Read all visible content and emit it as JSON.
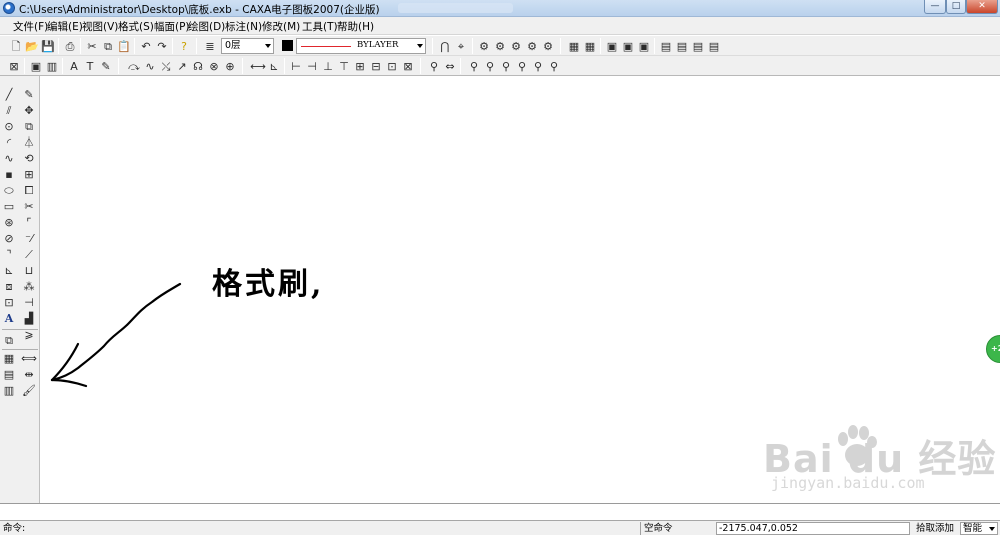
{
  "window": {
    "title": "C:\\Users\\Administrator\\Desktop\\底板.exb - CAXA电子图板2007(企业版)",
    "min_glyph": "—",
    "max_glyph": "□",
    "close_glyph": "✕"
  },
  "menu": [
    "文件(F)",
    "编辑(E)",
    "视图(V)",
    "格式(S)",
    "幅面(P)",
    "绘图(D)",
    "标注(N)",
    "修改(M)",
    "工具(T)",
    "帮助(H)"
  ],
  "toolbar": {
    "layer_value": "0层",
    "color_value": "#000000",
    "linetype_value": "BYLAYER",
    "line_color": "#e0262d"
  },
  "canvas": {
    "annotation": "格式刷,",
    "side_badge": "+2"
  },
  "watermark": {
    "brand": "Bai  du 经验",
    "url": "jingyan.baidu.com"
  },
  "status": {
    "command_label": "命令:",
    "command_state": "空命令",
    "coordinates": "-2175.047,0.052",
    "snap_label": "拾取添加",
    "snap_mode": "智能"
  },
  "icons": {
    "tb1": [
      "new-file-icon",
      "open-icon",
      "save-icon",
      "print-icon",
      "cut-icon",
      "copy-icon",
      "paste-icon",
      "undo-icon",
      "redo-icon",
      "help-icon",
      "layer-icon",
      "color-icon",
      "linetype-icon",
      "polyline-icon",
      "snap-icon",
      "view-icon",
      "block-icon",
      "image-icon",
      "dimension-icon",
      "attribute-icon",
      "format-brush-icon"
    ],
    "left_col_a": [
      "line-icon",
      "parallel-line-icon",
      "circle-icon",
      "arc-icon",
      "spline-icon",
      "point-icon",
      "ellipse-icon",
      "rectangle-icon",
      "polygon-icon",
      "hatch-icon",
      "centerline-icon",
      "equidistant-icon",
      "frame-icon",
      "image-frame-icon",
      "text-icon",
      "block-insert-icon",
      "title-block-icon",
      "parts-library-icon",
      "parts-library2-icon"
    ],
    "left_col_b": [
      "erase-icon",
      "move-icon",
      "copy-icon",
      "mirror-icon",
      "rotate-icon",
      "array-icon",
      "scale-icon",
      "trim-icon",
      "fillet-icon",
      "break-icon",
      "extend-icon",
      "stretch-icon",
      "explode-icon",
      "fit-icon",
      "edit-icon",
      "edit2-icon",
      "parametric-icon",
      "match-icon",
      "format-brush-icon"
    ]
  }
}
